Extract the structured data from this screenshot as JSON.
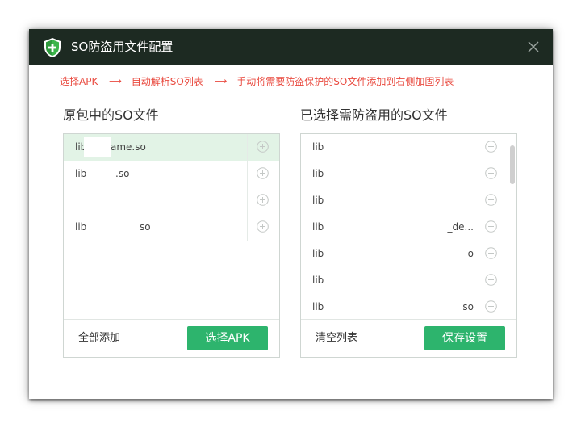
{
  "window": {
    "title": "SO防盗用文件配置",
    "logo_icon": "shield-plus-icon",
    "close_icon": "close-icon"
  },
  "steps": {
    "step1": "选择APK",
    "step2": "自动解析SO列表",
    "step3": "手动将需要防盗保护的SO文件添加到右侧加固列表",
    "arrow": "⟶"
  },
  "left_panel": {
    "title": "原包中的SO文件",
    "items": [
      {
        "prefix": "lib",
        "suffix": "ame.so",
        "selected": true
      },
      {
        "prefix": "lib",
        "suffix": ".so",
        "selected": false
      },
      {
        "prefix": "",
        "suffix": "",
        "selected": false
      },
      {
        "prefix": "lib",
        "suffix": "so",
        "selected": false
      }
    ],
    "add_all_label": "全部添加",
    "select_apk_label": "选择APK"
  },
  "right_panel": {
    "title": "已选择需防盗用的SO文件",
    "items": [
      {
        "prefix": "lib",
        "suffix": ""
      },
      {
        "prefix": "lib",
        "suffix": ""
      },
      {
        "prefix": "lib",
        "suffix": ""
      },
      {
        "prefix": "lib",
        "suffix": "_de..."
      },
      {
        "prefix": "lib",
        "suffix": "o"
      },
      {
        "prefix": "lib",
        "suffix": ""
      },
      {
        "prefix": "lib",
        "suffix": "so"
      }
    ],
    "clear_label": "清空列表",
    "save_label": "保存设置"
  },
  "colors": {
    "titlebar": "#1d2a22",
    "accent_green": "#2db46d",
    "step_red": "#e94a3f",
    "selected_row": "#e2f3e6"
  }
}
